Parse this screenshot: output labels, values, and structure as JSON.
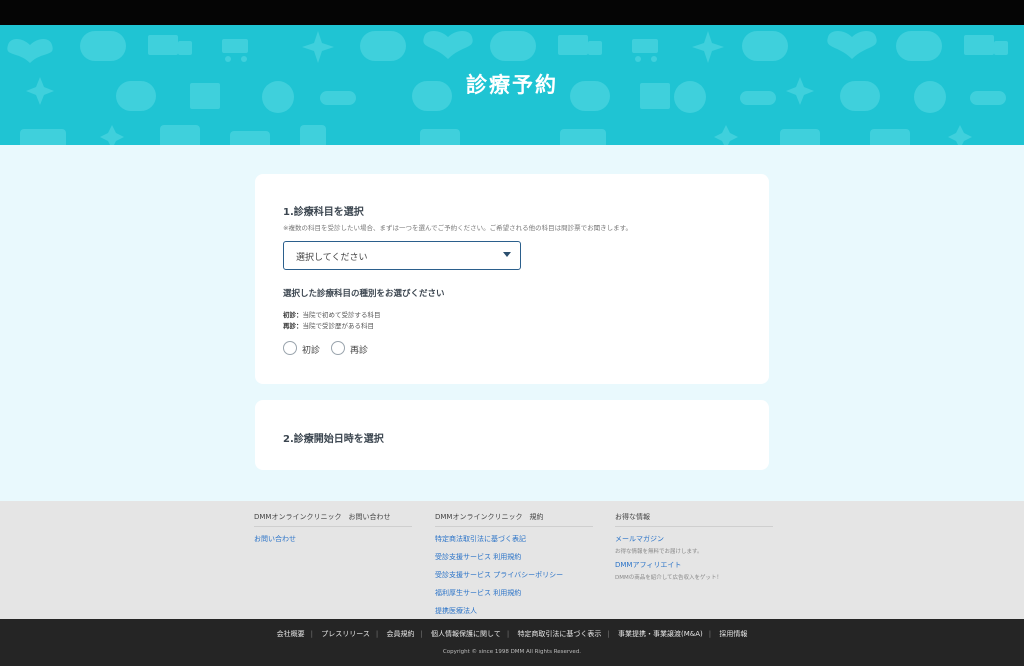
{
  "header": {
    "title": "診療予約"
  },
  "section1": {
    "title": "1.診療科目を選択",
    "note": "※複数の科目を受診したい場合、まずは一つを選んでご予約ください。ご希望される他の科目は問診票でお聞きします。",
    "select_value": "選択してください",
    "type_title": "選択した診療科目の種別をお選びください",
    "descriptions": [
      {
        "term": "初診：",
        "text": "当院で初めて受診する科目"
      },
      {
        "term": "再診：",
        "text": "当院で受診歴がある科目"
      }
    ],
    "radios": [
      "初診",
      "再診"
    ]
  },
  "section2": {
    "title": "2.診療開始日時を選択"
  },
  "footer": {
    "columns": [
      {
        "title": "DMMオンラインクリニック　お問い合わせ",
        "links": [
          "お問い合わせ"
        ]
      },
      {
        "title": "DMMオンラインクリニック　規約",
        "links": [
          "特定商法取引法に基づく表記",
          "受診支援サービス 利用規約",
          "受診支援サービス プライバシーポリシー",
          "福利厚生サービス 利用規約",
          "提携医療法人"
        ]
      },
      {
        "title": "お得な情報",
        "items": [
          {
            "link": "メールマガジン",
            "desc": "お得な情報を無料でお届けします。"
          },
          {
            "link": "DMMアフィリエイト",
            "desc": "DMMの商品を紹介して広告収入をゲット！"
          }
        ]
      }
    ],
    "nav": [
      "会社概要",
      "プレスリリース",
      "会員規約",
      "個人情報保護に関して",
      "特定商取引法に基づく表示",
      "事業提携・事業譲渡(M&A)",
      "採用情報"
    ],
    "copyright": "Copyright © since 1998 DMM All Rights Reserved."
  },
  "colors": {
    "hero": "#1fc4d3",
    "page_bg": "#e9f9fd",
    "select_border": "#2b5f8c",
    "link": "#2a73c8"
  },
  "icons": [
    "heart-pulse-icon",
    "chat-bubble-icon",
    "truck-icon",
    "cart-icon",
    "sparkle-icon",
    "gift-icon",
    "head-icon",
    "pill-icon"
  ]
}
